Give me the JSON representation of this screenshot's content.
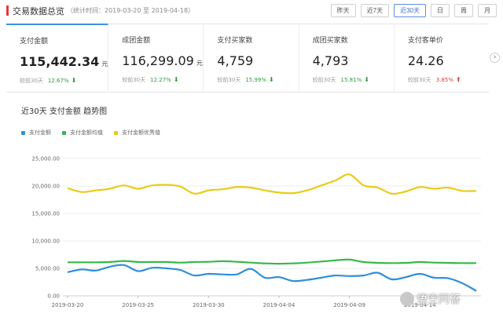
{
  "header": {
    "title": "交易数据总览",
    "subtitle": "（统计时间：2019-03-20 至 2019-04-18）",
    "ranges": [
      "昨天",
      "近7天",
      "近30天",
      "日",
      "周",
      "月"
    ],
    "active_range": 2
  },
  "metrics": [
    {
      "label": "支付金额",
      "value": "115,442.34",
      "unit": "元",
      "cmp_label": "较前30天",
      "pct": "12.67%",
      "dir": "down"
    },
    {
      "label": "成团金额",
      "value": "116,299.09",
      "unit": "元",
      "cmp_label": "较前30天",
      "pct": "12.27%",
      "dir": "down"
    },
    {
      "label": "支付买家数",
      "value": "4,759",
      "unit": "",
      "cmp_label": "较前30天",
      "pct": "15.99%",
      "dir": "down"
    },
    {
      "label": "成团买家数",
      "value": "4,793",
      "unit": "",
      "cmp_label": "较前30天",
      "pct": "15.81%",
      "dir": "down"
    },
    {
      "label": "支付客单价",
      "value": "24.26",
      "unit": "",
      "cmp_label": "较前30天",
      "pct": "3.85%",
      "dir": "up"
    }
  ],
  "active_metric": 0,
  "icons": {
    "next": "chevron-right-icon",
    "down": "arrow-down-icon",
    "up": "arrow-up-icon"
  },
  "colors": {
    "accent": "#3f8ee8",
    "down": "#2e9c3e",
    "up": "#e4393c"
  },
  "watermark": {
    "text": "悟空问答"
  },
  "chart_data": {
    "type": "line",
    "title": "近30天 支付金额 趋势图",
    "x": [
      "2019-03-20",
      "2019-03-21",
      "2019-03-22",
      "2019-03-23",
      "2019-03-24",
      "2019-03-25",
      "2019-03-26",
      "2019-03-27",
      "2019-03-28",
      "2019-03-29",
      "2019-03-30",
      "2019-03-31",
      "2019-04-01",
      "2019-04-02",
      "2019-04-03",
      "2019-04-04",
      "2019-04-05",
      "2019-04-06",
      "2019-04-07",
      "2019-04-08",
      "2019-04-09",
      "2019-04-10",
      "2019-04-11",
      "2019-04-12",
      "2019-04-13",
      "2019-04-14",
      "2019-04-15",
      "2019-04-16",
      "2019-04-17",
      "2019-04-18"
    ],
    "x_tick_labels": [
      "2019-03-20",
      "2019-03-25",
      "2019-03-30",
      "2019-04-04",
      "2019-04-09",
      "2019-04-14"
    ],
    "y_ticks": [
      "0.00",
      "5,000.00",
      "10,000.00",
      "15,000.00",
      "20,000.00",
      "25,000.00"
    ],
    "ylim": [
      0,
      25000
    ],
    "grid": true,
    "legend": "top-left",
    "series": [
      {
        "name": "支付金额",
        "color": "#2f8fd9",
        "values": [
          4300,
          4800,
          4600,
          5300,
          5600,
          4500,
          5100,
          5000,
          4700,
          3700,
          4000,
          3900,
          3900,
          4900,
          3300,
          3400,
          2700,
          2900,
          3300,
          3700,
          3600,
          3700,
          4200,
          3000,
          3400,
          4000,
          3300,
          3200,
          2300,
          900
        ]
      },
      {
        "name": "支付金额均值",
        "color": "#38b84a",
        "values": [
          6100,
          6100,
          6100,
          6150,
          6350,
          6150,
          6150,
          6150,
          6050,
          6150,
          6200,
          6300,
          6200,
          6050,
          5900,
          5850,
          5900,
          6050,
          6250,
          6450,
          6600,
          6150,
          6000,
          5950,
          6000,
          6150,
          6050,
          6000,
          5950,
          5950
        ]
      },
      {
        "name": "支付金额优秀值",
        "color": "#e8cc1a",
        "values": [
          19600,
          18900,
          19200,
          19500,
          20100,
          19500,
          20100,
          20200,
          19900,
          18600,
          19200,
          19400,
          19800,
          19700,
          19200,
          18800,
          18700,
          19200,
          20100,
          21000,
          22100,
          20100,
          19700,
          18600,
          19000,
          19800,
          19500,
          19700,
          19100,
          19100
        ]
      }
    ]
  }
}
